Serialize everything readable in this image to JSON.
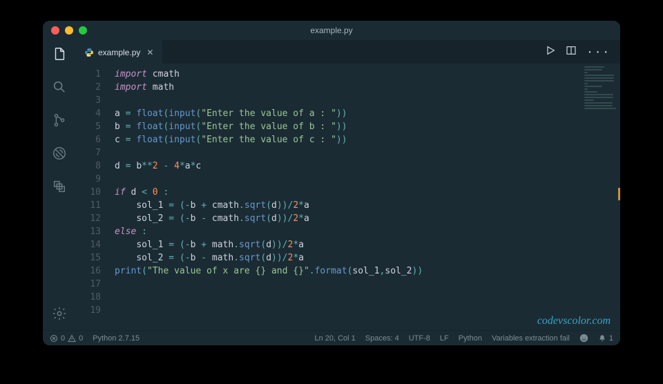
{
  "window_title": "example.py",
  "tab": {
    "filename": "example.py"
  },
  "actions": {
    "run": "▷",
    "split": "⫿⫿",
    "more": "···"
  },
  "gutter_start": 1,
  "gutter_end": 19,
  "code": {
    "l1": {
      "kw": "import",
      "mod": "cmath"
    },
    "l2": {
      "kw": "import",
      "mod": "math"
    },
    "l4": {
      "v": "a",
      "eq": " = ",
      "fn1": "float",
      "p1": "(",
      "fn2": "input",
      "p2": "(",
      "s": "\"Enter the value of a : \"",
      "p3": "))"
    },
    "l5": {
      "v": "b",
      "eq": " = ",
      "fn1": "float",
      "p1": "(",
      "fn2": "input",
      "p2": "(",
      "s": "\"Enter the value of b : \"",
      "p3": "))"
    },
    "l6": {
      "v": "c",
      "eq": " = ",
      "fn1": "float",
      "p1": "(",
      "fn2": "input",
      "p2": "(",
      "s": "\"Enter the value of c : \"",
      "p3": "))"
    },
    "l8": {
      "v": "d",
      "eq": " = ",
      "expr_id1": "b",
      "op1": "**",
      "n1": "2",
      "op2": " - ",
      "n2": "4",
      "op3": "*",
      "id2": "a",
      "op4": "*",
      "id3": "c"
    },
    "l10": {
      "kw": "if",
      "sp": " ",
      "id": "d",
      "op": " < ",
      "n": "0",
      "sp2": " ",
      "colon": ":"
    },
    "l11": {
      "indent": "    ",
      "v": "sol_1",
      "eq": " = ",
      "p1": "(",
      "op1": "-",
      "id1": "b",
      "op2": " + ",
      "mod": "cmath",
      "dot": ".",
      "fn": "sqrt",
      "p2": "(",
      "id2": "d",
      "p3": "))",
      "op3": "/",
      "n1": "2",
      "op4": "*",
      "id3": "a"
    },
    "l12": {
      "indent": "    ",
      "v": "sol_2",
      "eq": " = ",
      "p1": "(",
      "op1": "-",
      "id1": "b",
      "op2": " - ",
      "mod": "cmath",
      "dot": ".",
      "fn": "sqrt",
      "p2": "(",
      "id2": "d",
      "p3": "))",
      "op3": "/",
      "n1": "2",
      "op4": "*",
      "id3": "a"
    },
    "l13": {
      "kw": "else",
      "sp": " ",
      "colon": ":"
    },
    "l14": {
      "indent": "    ",
      "v": "sol_1",
      "eq": " = ",
      "p1": "(",
      "op1": "-",
      "id1": "b",
      "op2": " + ",
      "mod": "math",
      "dot": ".",
      "fn": "sqrt",
      "p2": "(",
      "id2": "d",
      "p3": "))",
      "op3": "/",
      "n1": "2",
      "op4": "*",
      "id3": "a"
    },
    "l15": {
      "indent": "    ",
      "v": "sol_2",
      "eq": " = ",
      "p1": "(",
      "op1": "-",
      "id1": "b",
      "op2": " - ",
      "mod": "math",
      "dot": ".",
      "fn": "sqrt",
      "p2": "(",
      "id2": "d",
      "p3": "))",
      "op3": "/",
      "n1": "2",
      "op4": "*",
      "id3": "a"
    },
    "l16": {
      "fn": "print",
      "p1": "(",
      "s": "\"The value of x are {} and {}\"",
      "dot": ".",
      "fn2": "format",
      "p2": "(",
      "id1": "sol_1",
      "comma": ",",
      "id2": "sol_2",
      "p3": "))"
    }
  },
  "status": {
    "errors": "0",
    "warnings": "0",
    "python_version": "Python 2.7.15",
    "cursor": "Ln 20, Col 1",
    "spaces": "Spaces: 4",
    "encoding": "UTF-8",
    "eol": "LF",
    "language": "Python",
    "message": "Variables extraction fail",
    "notifications": "1"
  },
  "watermark": "codevscolor.com"
}
